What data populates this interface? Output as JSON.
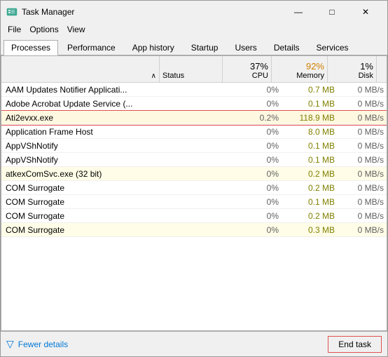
{
  "titleBar": {
    "icon": "task-manager-icon",
    "title": "Task Manager",
    "minimize": "—",
    "maximize": "□",
    "close": "✕"
  },
  "menuBar": {
    "items": [
      "File",
      "Options",
      "View"
    ]
  },
  "tabs": [
    {
      "label": "Processes",
      "active": true
    },
    {
      "label": "Performance",
      "active": false
    },
    {
      "label": "App history",
      "active": false
    },
    {
      "label": "Startup",
      "active": false
    },
    {
      "label": "Users",
      "active": false
    },
    {
      "label": "Details",
      "active": false
    },
    {
      "label": "Services",
      "active": false
    }
  ],
  "tableHeader": {
    "nameArrow": "∧",
    "statusLabel": "Status",
    "cpu": {
      "value": "37%",
      "label": "CPU"
    },
    "memory": {
      "value": "92%",
      "label": "Memory"
    },
    "disk": {
      "value": "1%",
      "label": "Disk"
    }
  },
  "rows": [
    {
      "name": "AAM Updates Notifier Applicati...",
      "status": "",
      "cpu": "0%",
      "memory": "0.7 MB",
      "disk": "0 MB/s",
      "selected": false,
      "bgClass": ""
    },
    {
      "name": "Adobe Acrobat Update Service (...",
      "status": "",
      "cpu": "0%",
      "memory": "0.1 MB",
      "disk": "0 MB/s",
      "selected": false,
      "bgClass": ""
    },
    {
      "name": "Ati2evxx.exe",
      "status": "",
      "cpu": "0.2%",
      "memory": "118.9 MB",
      "disk": "0 MB/s",
      "selected": true,
      "bgClass": ""
    },
    {
      "name": "Application Frame Host",
      "status": "",
      "cpu": "0%",
      "memory": "8.0 MB",
      "disk": "0 MB/s",
      "selected": false,
      "bgClass": ""
    },
    {
      "name": "AppVShNotify",
      "status": "",
      "cpu": "0%",
      "memory": "0.1 MB",
      "disk": "0 MB/s",
      "selected": false,
      "bgClass": ""
    },
    {
      "name": "AppVShNotify",
      "status": "",
      "cpu": "0%",
      "memory": "0.1 MB",
      "disk": "0 MB/s",
      "selected": false,
      "bgClass": ""
    },
    {
      "name": "atkexComSvc.exe (32 bit)",
      "status": "",
      "cpu": "0%",
      "memory": "0.2 MB",
      "disk": "0 MB/s",
      "selected": false,
      "bgClass": "bg-yellow-light"
    },
    {
      "name": "COM Surrogate",
      "status": "",
      "cpu": "0%",
      "memory": "0.2 MB",
      "disk": "0 MB/s",
      "selected": false,
      "bgClass": ""
    },
    {
      "name": "COM Surrogate",
      "status": "",
      "cpu": "0%",
      "memory": "0.1 MB",
      "disk": "0 MB/s",
      "selected": false,
      "bgClass": ""
    },
    {
      "name": "COM Surrogate",
      "status": "",
      "cpu": "0%",
      "memory": "0.2 MB",
      "disk": "0 MB/s",
      "selected": false,
      "bgClass": ""
    },
    {
      "name": "COM Surrogate",
      "status": "",
      "cpu": "0%",
      "memory": "0.3 MB",
      "disk": "0 MB/s",
      "selected": false,
      "bgClass": "bg-yellow-light"
    }
  ],
  "bottomBar": {
    "fewerDetails": "Fewer details",
    "endTask": "End task"
  }
}
